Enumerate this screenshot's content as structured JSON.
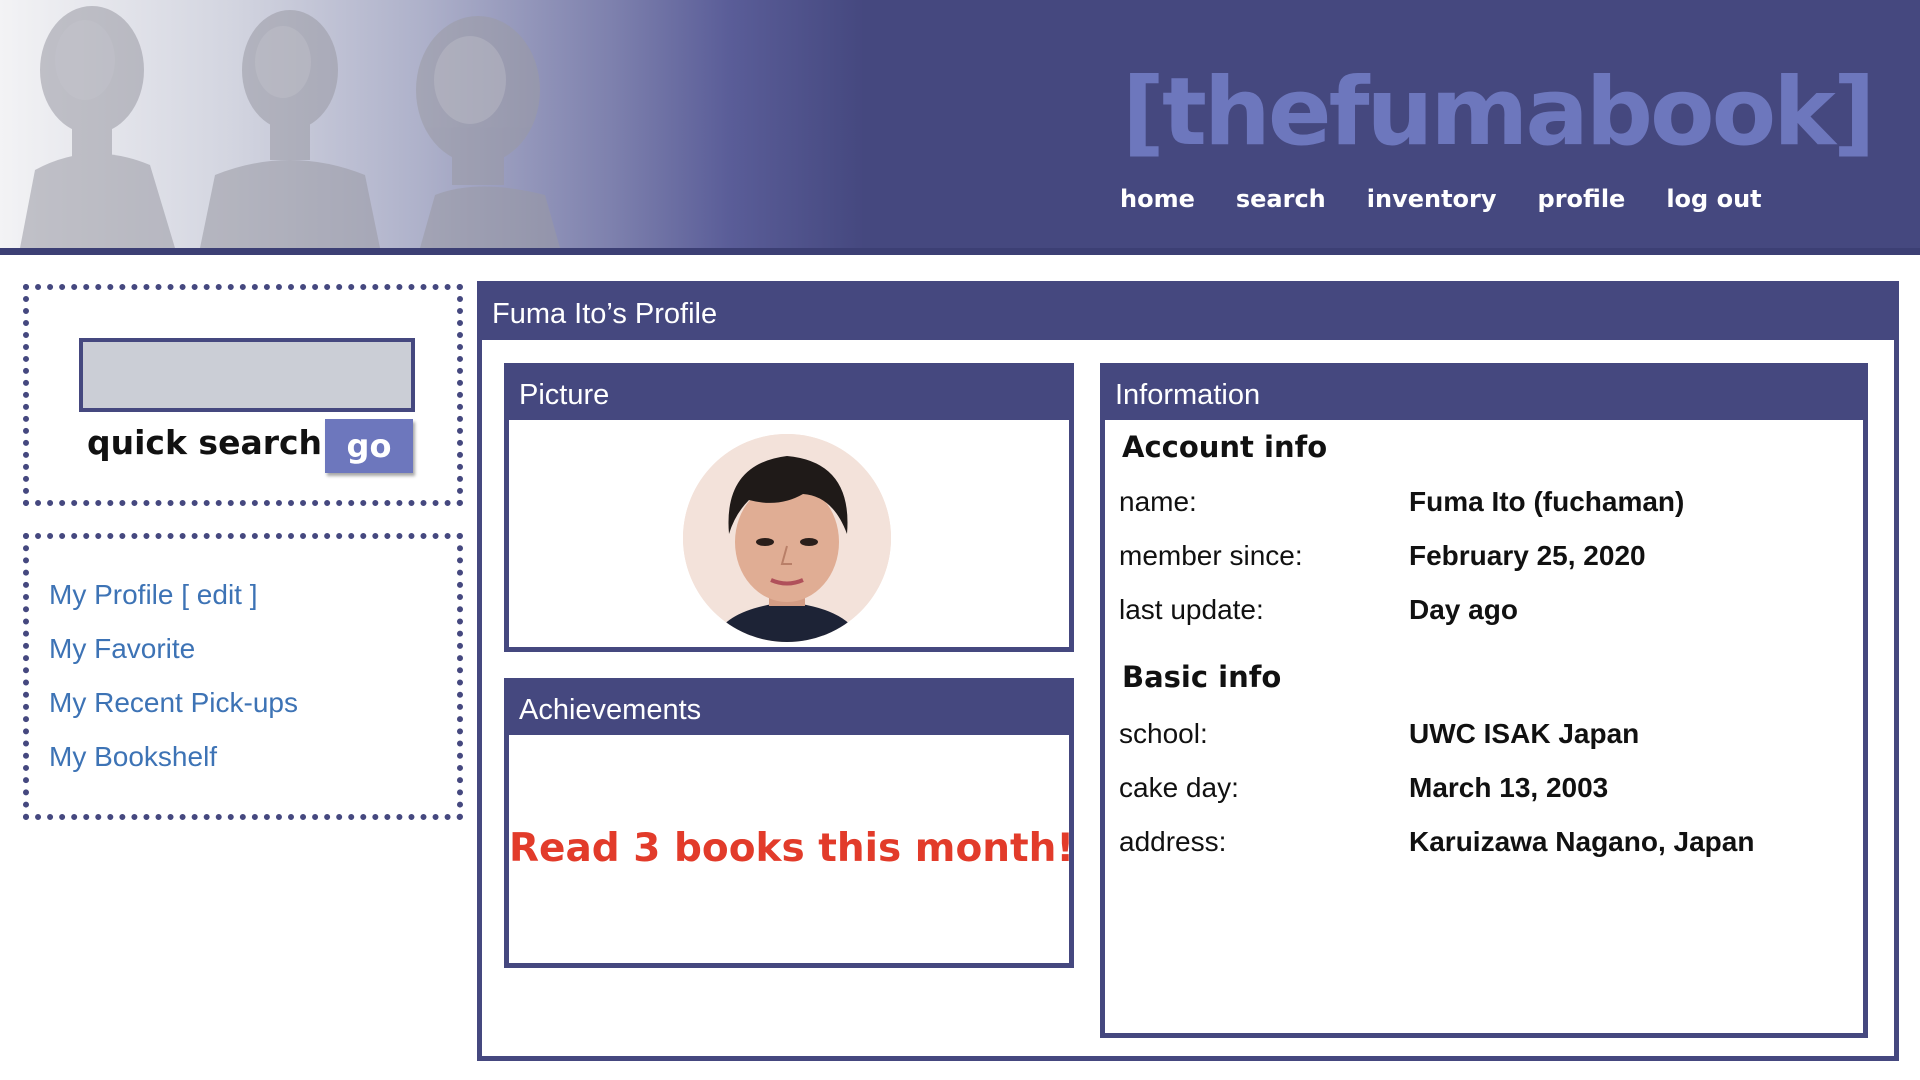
{
  "header": {
    "logo": "[thefumabook]",
    "nav": [
      {
        "label": "home"
      },
      {
        "label": "search"
      },
      {
        "label": "inventory"
      },
      {
        "label": "profile"
      },
      {
        "label": "log out"
      }
    ]
  },
  "sidebar": {
    "search": {
      "value": "",
      "label": "quick search",
      "button": "go"
    },
    "links": [
      {
        "label": "My Profile [ edit ]"
      },
      {
        "label": "My Favorite"
      },
      {
        "label": "My Recent Pick-ups"
      },
      {
        "label": "My Bookshelf"
      }
    ]
  },
  "main": {
    "title": "Fuma Ito’s Profile",
    "picture": {
      "title": "Picture"
    },
    "achievements": {
      "title": "Achievements",
      "text": "Read 3 books this month!"
    },
    "information": {
      "title": "Information",
      "account": {
        "title": "Account info",
        "rows": [
          {
            "label": "name:",
            "value": "Fuma Ito (fuchaman)"
          },
          {
            "label": "member since:",
            "value": "February 25, 2020"
          },
          {
            "label": "last update:",
            "value": "Day ago"
          }
        ]
      },
      "basic": {
        "title": "Basic info",
        "rows": [
          {
            "label": "school:",
            "value": "UWC ISAK Japan"
          },
          {
            "label": "cake day:",
            "value": "March 13, 2003"
          },
          {
            "label": "address:",
            "value": "Karuizawa Nagano, Japan"
          }
        ]
      }
    }
  },
  "colors": {
    "brand": "#45487f",
    "logo": "#6d77bd",
    "link": "#3d73b5",
    "achievement": "#e23b2a",
    "input_bg": "#cbced6"
  }
}
